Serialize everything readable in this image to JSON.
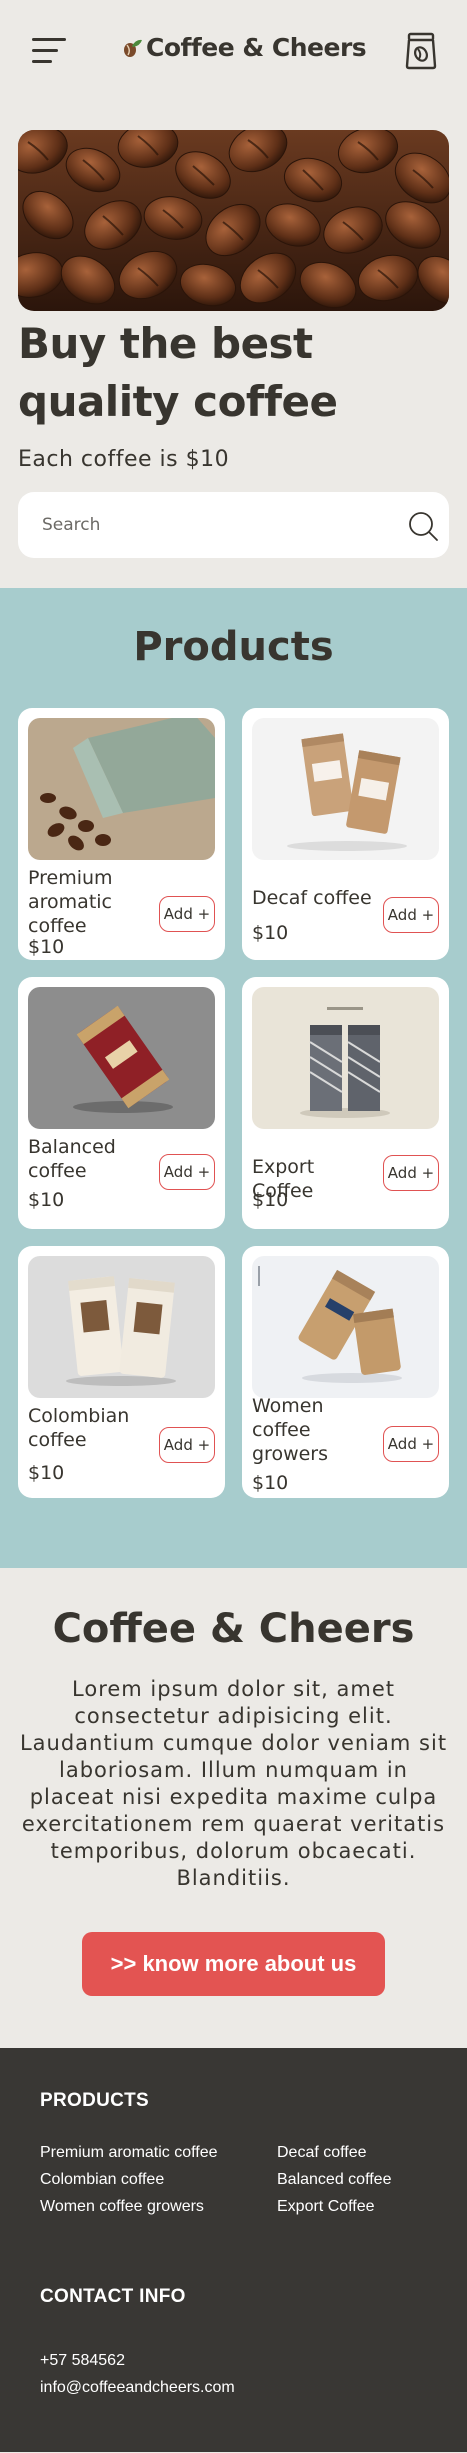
{
  "header": {
    "brand": "Coffee & Cheers"
  },
  "hero": {
    "title": "Buy the best quality coffee",
    "subtitle": "Each coffee is $10"
  },
  "search": {
    "placeholder": "Search"
  },
  "products": {
    "title": "Products",
    "items": [
      {
        "name": "Premium aromatic coffee",
        "price": "$10",
        "add_label": "Add +"
      },
      {
        "name": "Decaf coffee",
        "price": "$10",
        "add_label": "Add +"
      },
      {
        "name": "Balanced coffee",
        "price": "$10",
        "add_label": "Add +"
      },
      {
        "name": "Export Coffee",
        "price": "$10",
        "add_label": "Add +"
      },
      {
        "name": "Colombian coffee",
        "price": "$10",
        "add_label": "Add +"
      },
      {
        "name": "Women coffee growers",
        "price": "$10",
        "add_label": "Add +"
      }
    ]
  },
  "about": {
    "title": "Coffee & Cheers",
    "text": "Lorem ipsum dolor sit, amet consectetur adipisicing elit. Laudantium cumque dolor veniam sit laboriosam. Illum numquam in placeat nisi expedita maxime culpa exercitationem rem quaerat veritatis temporibus, dolorum obcaecati. Blanditiis.",
    "cta_label": ">> know more about us"
  },
  "footer": {
    "products_heading": "PRODUCTS",
    "product_links": [
      "Premium aromatic coffee",
      "Decaf coffee",
      "Colombian coffee",
      "Balanced coffee",
      "Women coffee growers",
      "Export Coffee"
    ],
    "contact_heading": "CONTACT INFO",
    "phone": "+57 584562",
    "email": "info@coffeeandcheers.com"
  },
  "colors": {
    "background": "#eceae6",
    "products_bg": "#a7cccd",
    "accent": "#e35452",
    "text": "#38352f",
    "footer_bg": "#393734"
  },
  "icons": [
    "menu-icon",
    "coffee-bean-logo-icon",
    "coffee-bag-icon",
    "search-icon"
  ]
}
